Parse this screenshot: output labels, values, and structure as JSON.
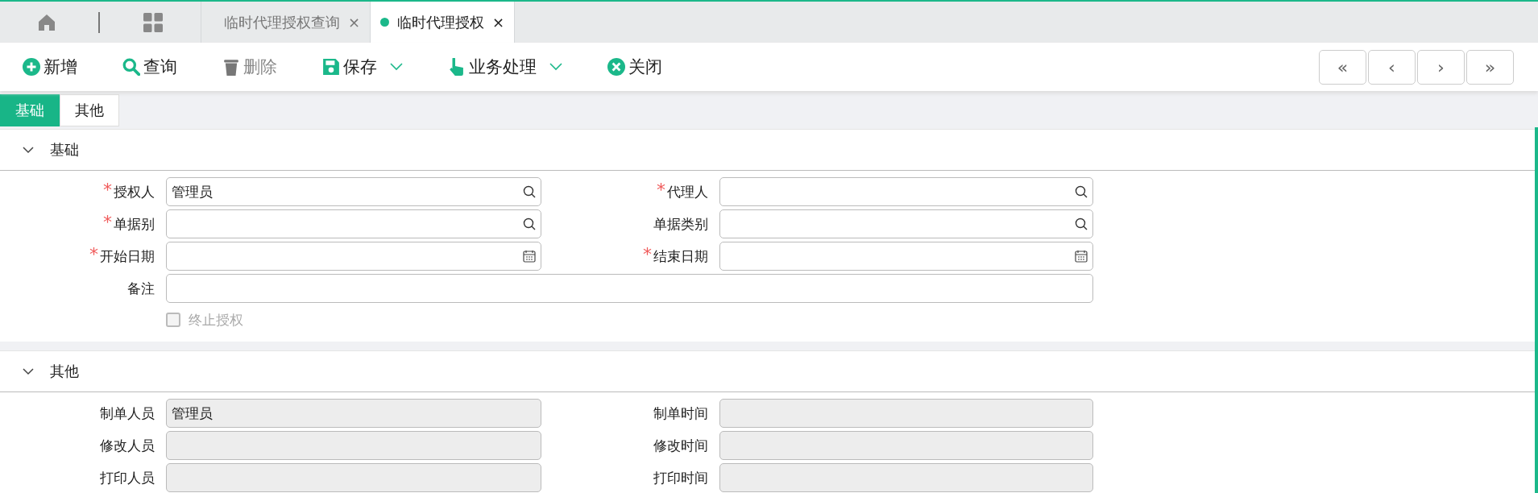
{
  "top_tabs": [
    {
      "label": "临时代理授权查询",
      "selected": false,
      "close": "×"
    },
    {
      "label": "临时代理授权",
      "selected": true,
      "close": "×"
    }
  ],
  "toolbar": [
    {
      "label": "新增",
      "kind": "add",
      "disabled": false,
      "dropdown": false
    },
    {
      "label": "查询",
      "kind": "search",
      "disabled": false,
      "dropdown": false
    },
    {
      "label": "删除",
      "kind": "delete",
      "disabled": true,
      "dropdown": false
    },
    {
      "label": "保存",
      "kind": "save",
      "disabled": false,
      "dropdown": true
    },
    {
      "label": "业务处理",
      "kind": "process",
      "disabled": false,
      "dropdown": true
    },
    {
      "label": "关闭",
      "kind": "close",
      "disabled": false,
      "dropdown": false
    }
  ],
  "pager": [
    "«",
    "‹",
    "›",
    "»"
  ],
  "sub_tabs": [
    {
      "label": "基础",
      "selected": true
    },
    {
      "label": "其他",
      "selected": false
    }
  ],
  "sections": [
    {
      "title": "基础",
      "expanded": true,
      "fields": [
        {
          "label": "授权人",
          "required_mark": "*",
          "kind": "lookup",
          "value": "管理员"
        },
        {
          "label": "代理人",
          "required_mark": "*",
          "kind": "lookup"
        },
        {
          "label": "单据别",
          "required_mark": "*",
          "kind": "lookup"
        },
        {
          "label": "单据类别",
          "kind": "lookup"
        },
        {
          "label": "开始日期",
          "required_mark": "*",
          "kind": "date"
        },
        {
          "label": "结束日期",
          "required_mark": "*",
          "kind": "date"
        },
        {
          "label": "备注",
          "kind": "wide"
        }
      ],
      "checkbox": {
        "label": "终止授权",
        "checked": false,
        "disabled": true
      }
    },
    {
      "title": "其他",
      "expanded": true,
      "fields": [
        {
          "label": "制单人员",
          "kind": "readonly",
          "value": "管理员"
        },
        {
          "label": "制单时间",
          "kind": "readonly"
        },
        {
          "label": "修改人员",
          "kind": "readonly"
        },
        {
          "label": "修改时间",
          "kind": "readonly"
        },
        {
          "label": "打印人员",
          "kind": "readonly"
        },
        {
          "label": "打印时间",
          "kind": "readonly"
        }
      ]
    }
  ]
}
